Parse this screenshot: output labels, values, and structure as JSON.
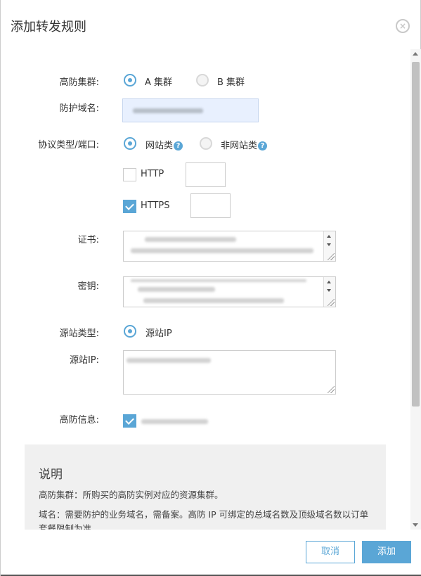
{
  "dialog": {
    "title": "添加转发规则",
    "close_icon": "close-circle-icon"
  },
  "form": {
    "cluster": {
      "label": "高防集群:",
      "options": [
        "A 集群",
        "B 集群"
      ],
      "selected": "A 集群"
    },
    "domain": {
      "label": "防护域名:"
    },
    "protocol": {
      "label": "协议类型/端口:",
      "options": [
        "网站类",
        "非网站类"
      ],
      "selected": "网站类",
      "help_icon": "?"
    },
    "http": {
      "label": "HTTP",
      "checked": false,
      "port": ""
    },
    "https": {
      "label": "HTTPS",
      "checked": true,
      "port": ""
    },
    "cert": {
      "label": "证书:"
    },
    "key": {
      "label": "密钥:"
    },
    "origin_type": {
      "label": "源站类型:",
      "option": "源站IP"
    },
    "origin_ip": {
      "label": "源站IP:"
    },
    "ddos_info": {
      "label": "高防信息:",
      "checked": true
    }
  },
  "info": {
    "title": "说明",
    "p1": "高防集群：所购买的高防实例对应的资源集群。",
    "p2": "域名：需要防护的业务域名，需备案。高防 IP 可绑定的总域名数及顶级域名数以订单套餐限制为准。"
  },
  "footer": {
    "cancel_label": "取消",
    "add_label": "添加"
  },
  "colors": {
    "accent": "#5aa6d6",
    "info_bg": "#f0f0f0"
  }
}
